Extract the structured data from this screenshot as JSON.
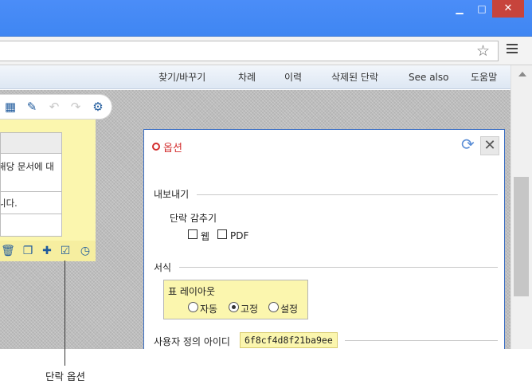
{
  "window": {
    "minimize_glyph": "▁",
    "maximize_glyph": "□",
    "close_glyph": "✕",
    "accent_color": "#4b8df8",
    "close_color": "#c7443c"
  },
  "browser": {
    "star_icon": "star-icon",
    "menu_icon": "hamburger-menu-icon"
  },
  "nav": {
    "items": [
      "찾기/바꾸기",
      "차례",
      "이력",
      "삭제된 단락",
      "See also",
      "도움말"
    ]
  },
  "paragraph_panel": {
    "table": {
      "header": "",
      "rows": [
        "해당 문서에 대",
        "니다.",
        "."
      ]
    },
    "background_color": "#fbf6ae"
  },
  "callout": {
    "label": "단락 옵션"
  },
  "dialog": {
    "title": "옵션",
    "title_color": "#d32f2f",
    "export_section": "내보내기",
    "hide_paragraph_label": "단락 감추기",
    "hide_options": [
      "웹",
      "PDF"
    ],
    "format_section": "서식",
    "table_layout_label": "표 레이아웃",
    "layout_options": [
      "자동",
      "고정",
      "설정"
    ],
    "layout_selected": "고정",
    "user_id_label": "사용자 정의 아이디",
    "user_id_value": "6f8cf4d8f21ba9ee"
  }
}
